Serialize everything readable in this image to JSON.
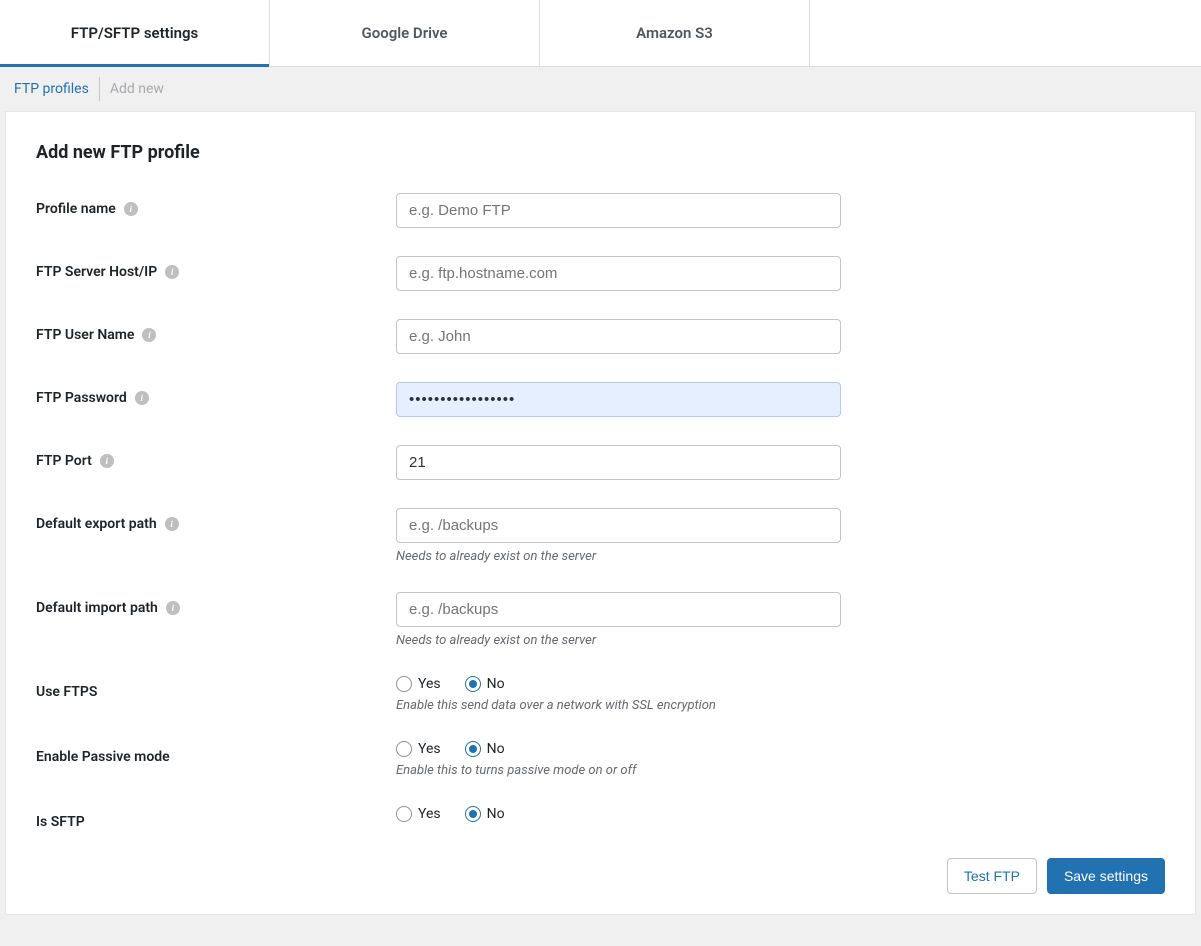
{
  "tabs_primary": [
    {
      "label": "FTP/SFTP settings",
      "active": true
    },
    {
      "label": "Google Drive",
      "active": false
    },
    {
      "label": "Amazon S3",
      "active": false
    }
  ],
  "tabs_secondary": {
    "profiles": "FTP profiles",
    "addnew": "Add new"
  },
  "panel_title": "Add new FTP profile",
  "fields": {
    "profile_name": {
      "label": "Profile name",
      "placeholder": "e.g. Demo FTP",
      "value": ""
    },
    "host": {
      "label": "FTP Server Host/IP",
      "placeholder": "e.g. ftp.hostname.com",
      "value": ""
    },
    "user": {
      "label": "FTP User Name",
      "placeholder": "e.g. John",
      "value": ""
    },
    "password": {
      "label": "FTP Password",
      "value": "•••••••••••••••••"
    },
    "port": {
      "label": "FTP Port",
      "value": "21"
    },
    "export_path": {
      "label": "Default export path",
      "placeholder": "e.g. /backups",
      "help": "Needs to already exist on the server",
      "value": ""
    },
    "import_path": {
      "label": "Default import path",
      "placeholder": "e.g. /backups",
      "help": "Needs to already exist on the server",
      "value": ""
    },
    "use_ftps": {
      "label": "Use FTPS",
      "help": "Enable this send data over a network with SSL encryption",
      "value": "No"
    },
    "passive": {
      "label": "Enable Passive mode",
      "help": "Enable this to turns passive mode on or off",
      "value": "No"
    },
    "is_sftp": {
      "label": "Is SFTP",
      "value": "No"
    }
  },
  "options": {
    "yes": "Yes",
    "no": "No"
  },
  "info_glyph": "i",
  "buttons": {
    "test": "Test FTP",
    "save": "Save settings"
  }
}
